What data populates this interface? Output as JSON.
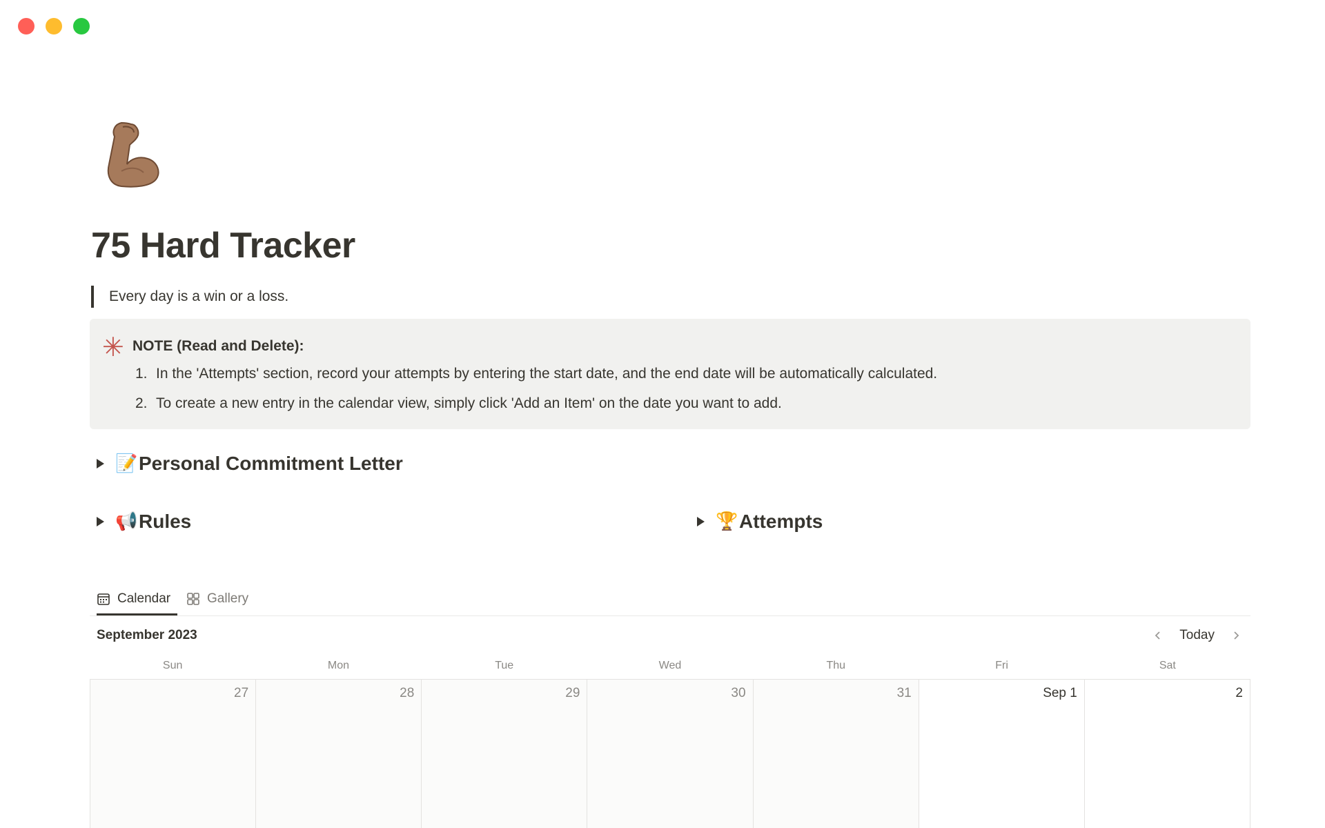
{
  "window": {
    "traffic_lights": {
      "close_color": "#ff5f57",
      "minimize_color": "#febc2e",
      "zoom_color": "#28c840"
    }
  },
  "page": {
    "icon": "flexed-biceps-icon",
    "title": "75 Hard Tracker",
    "quote": "Every day is a win or a loss.",
    "callout": {
      "icon": "asterisk-icon",
      "heading": "NOTE (Read and Delete):",
      "items": [
        {
          "number": "1.",
          "text": "In the 'Attempts' section, record your attempts by entering the start date, and the end date will be automatically calculated."
        },
        {
          "number": "2.",
          "text": "To create a new entry in the calendar view, simply click 'Add an Item' on the date you want to add."
        }
      ]
    },
    "toggles": {
      "commitment": {
        "emoji": "📝",
        "label": "Personal Commitment Letter"
      },
      "rules": {
        "emoji": "📢",
        "label": "Rules"
      },
      "attempts": {
        "emoji": "🏆",
        "label": "Attempts"
      }
    }
  },
  "views": {
    "tabs": [
      {
        "label": "Calendar",
        "icon": "calendar-icon",
        "active": true
      },
      {
        "label": "Gallery",
        "icon": "gallery-icon",
        "active": false
      }
    ]
  },
  "calendar": {
    "month_label": "September 2023",
    "today_label": "Today",
    "weekdays": [
      "Sun",
      "Mon",
      "Tue",
      "Wed",
      "Thu",
      "Fri",
      "Sat"
    ],
    "days": [
      {
        "label": "27",
        "current_month": false
      },
      {
        "label": "28",
        "current_month": false
      },
      {
        "label": "29",
        "current_month": false
      },
      {
        "label": "30",
        "current_month": false
      },
      {
        "label": "31",
        "current_month": false
      },
      {
        "label": "Sep 1",
        "current_month": true
      },
      {
        "label": "2",
        "current_month": true
      }
    ]
  }
}
